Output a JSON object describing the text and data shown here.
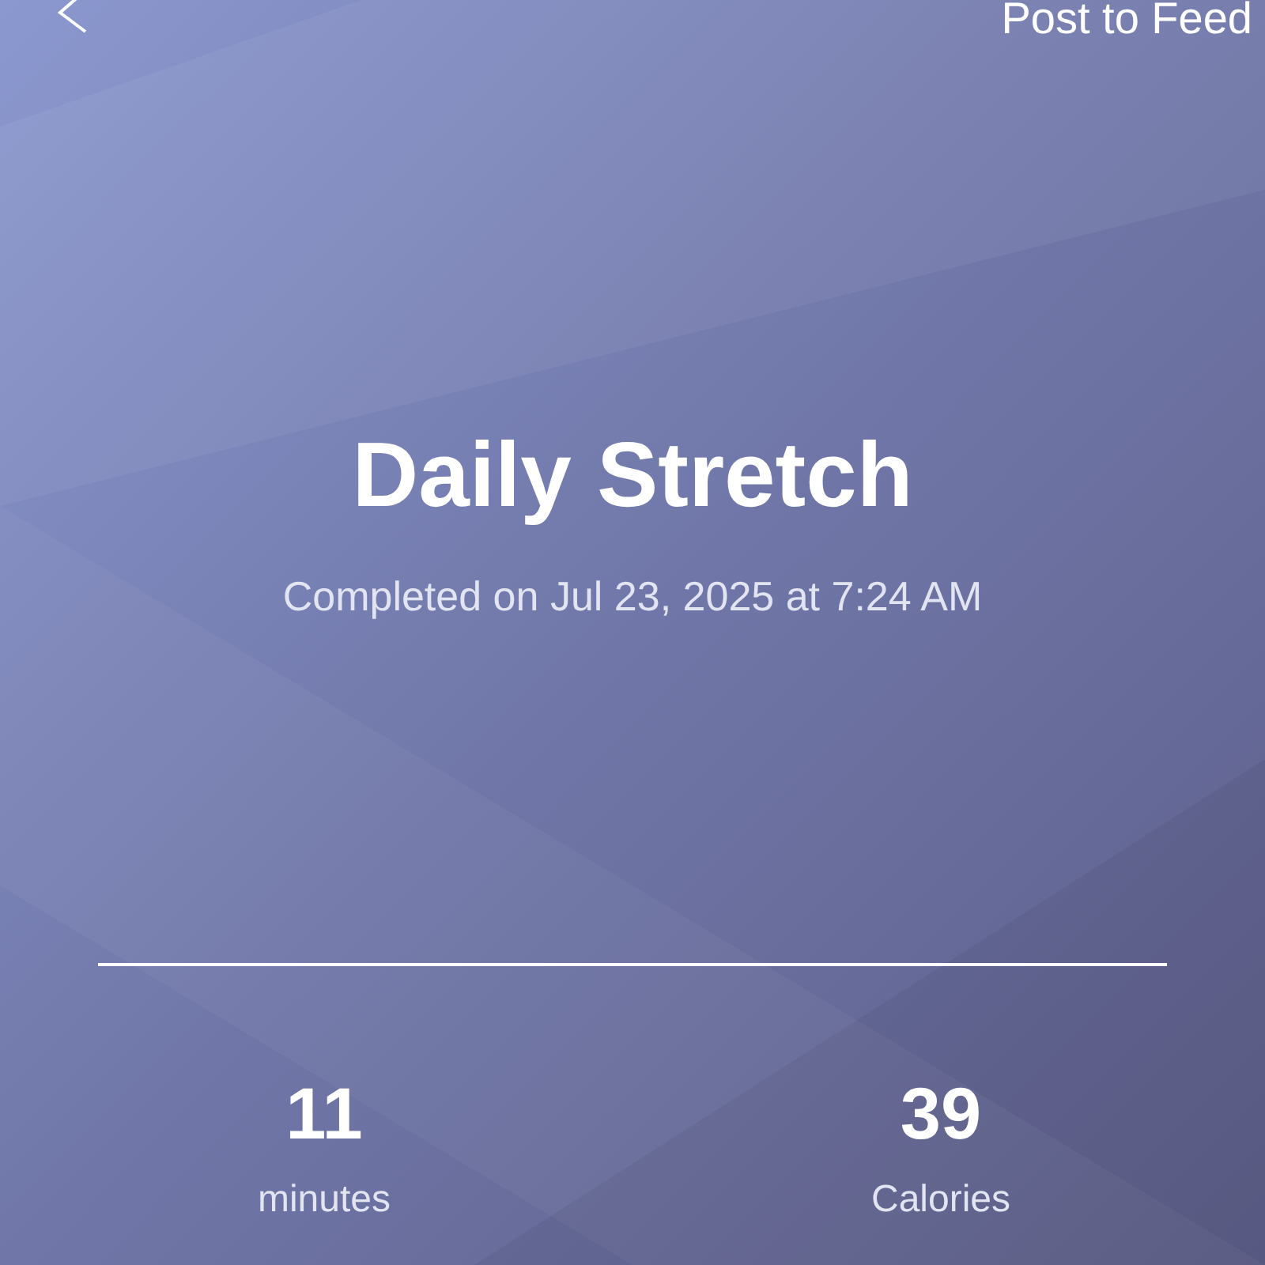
{
  "header": {
    "action": "Post to Feed"
  },
  "workout": {
    "title": "Daily Stretch",
    "completed": "Completed on Jul 23, 2025 at 7:24 AM"
  },
  "stats": [
    {
      "value": "11",
      "unit": "minutes"
    },
    {
      "value": "39",
      "unit": "Calories"
    }
  ]
}
